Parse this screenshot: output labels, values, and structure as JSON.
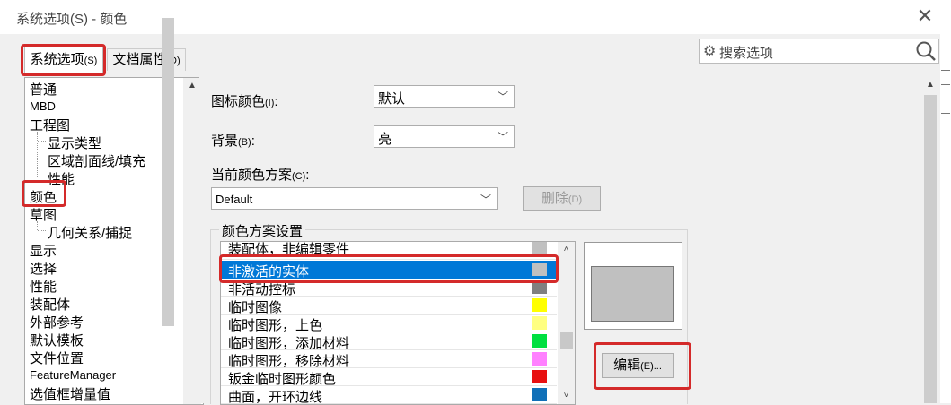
{
  "window": {
    "title": "系统选项(S) - 颜色",
    "close_glyph": "✕"
  },
  "tabs": [
    {
      "label": "系统选项",
      "suffix": "(S)",
      "active": true
    },
    {
      "label": "文档属性",
      "suffix": "(D)",
      "active": false
    }
  ],
  "search": {
    "placeholder": "搜索选项",
    "gear_icon": "gear-icon",
    "search_icon": "search-icon"
  },
  "tree": {
    "items": [
      "普通",
      "MBD",
      "工程图",
      "显示类型",
      "区域剖面线/填充",
      "性能",
      "颜色",
      "草图",
      "几何关系/捕捉",
      "显示",
      "选择",
      "性能",
      "装配体",
      "外部参考",
      "默认模板",
      "文件位置",
      "FeatureManager",
      "选值框增量值"
    ],
    "selected": "颜色"
  },
  "form": {
    "icon_color": {
      "label": "图标颜色",
      "suffix": "(I)",
      "colon": ":",
      "value": "默认"
    },
    "background": {
      "label": "背景",
      "suffix": "(B)",
      "colon": ":",
      "value": "亮"
    },
    "scheme": {
      "label": "当前颜色方案",
      "suffix": "(C)",
      "colon": ":",
      "value": "Default"
    },
    "delete_button": {
      "label": "删除",
      "suffix": "(D)",
      "enabled": false
    }
  },
  "scheme_settings": {
    "title": "颜色方案设置",
    "items": [
      {
        "label": "装配体，非编辑零件",
        "color": "#c0c0c0"
      },
      {
        "label": "非激活的实体",
        "color": "#c0c0c0"
      },
      {
        "label": "非活动控标",
        "color": "#808080"
      },
      {
        "label": "临时图像",
        "color": "#ffff00"
      },
      {
        "label": "临时图形，上色",
        "color": "#ffff80"
      },
      {
        "label": "临时图形，添加材料",
        "color": "#00e040"
      },
      {
        "label": "临时图形，移除材料",
        "color": "#ff80ff"
      },
      {
        "label": "钣金临时图形颜色",
        "color": "#e81010"
      },
      {
        "label": "曲面，开环边线",
        "color": "#1070b8"
      }
    ],
    "selected": "非激活的实体",
    "preview_color": "#c0c0c0",
    "edit_button": {
      "label": "编辑",
      "suffix": "(E)..."
    }
  }
}
